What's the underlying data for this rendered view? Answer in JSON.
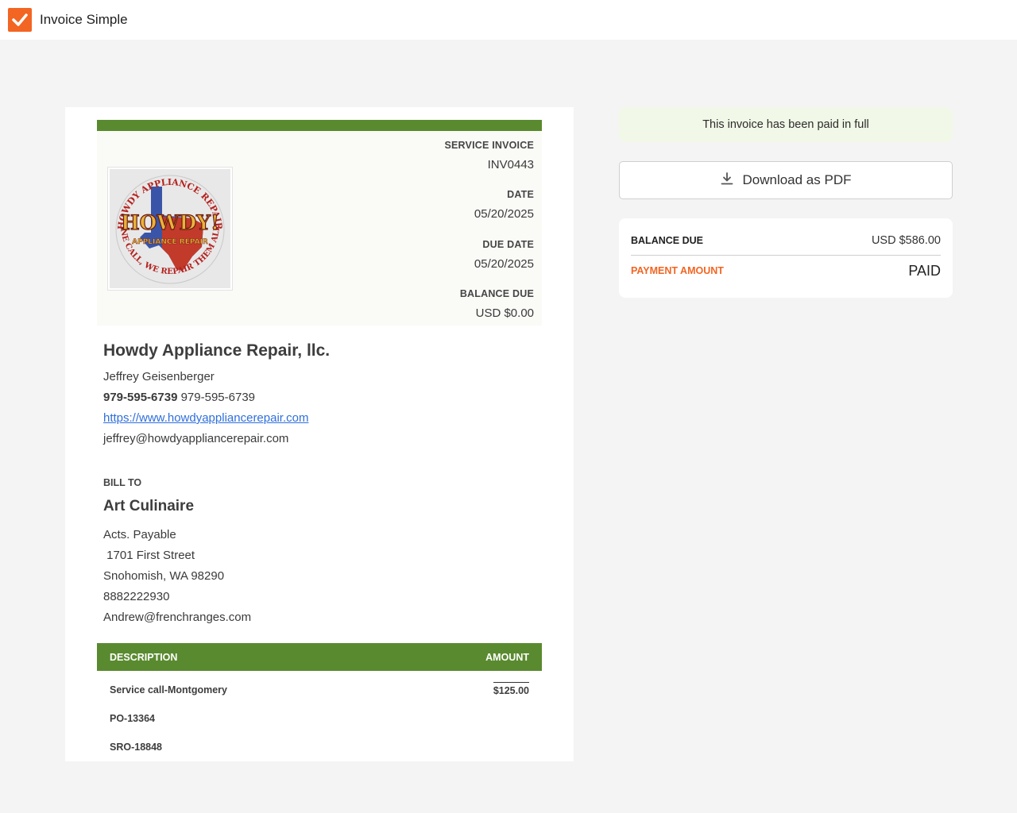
{
  "app": {
    "name": "Invoice Simple"
  },
  "invoice": {
    "type_label": "SERVICE INVOICE",
    "number": "INV0443",
    "date_label": "DATE",
    "date": "05/20/2025",
    "due_date_label": "DUE DATE",
    "due_date": "05/20/2025",
    "balance_label": "BALANCE DUE",
    "balance": "USD $0.00",
    "logo": {
      "arc_top": "HOWDY APPLIANCE REPAIR",
      "arc_bottom": "ONE CALL, WE REPAIR THEM ALL!",
      "center": "HOWDY!",
      "sub": "APPLIANCE REPAIR"
    }
  },
  "company": {
    "name": "Howdy Appliance Repair, llc.",
    "contact": "Jeffrey Geisenberger",
    "phone_bold": "979-595-6739",
    "phone": " 979-595-6739",
    "website": "https://www.howdyappliancerepair.com",
    "email": "jeffrey@howdyappliancerepair.com"
  },
  "bill_to": {
    "label": "BILL TO",
    "name": "Art Culinaire",
    "lines": [
      "Acts. Payable",
      " 1701 First Street",
      "Snohomish, WA 98290",
      "8882222930",
      "Andrew@frenchranges.com"
    ]
  },
  "table": {
    "headers": {
      "description": "DESCRIPTION",
      "amount": "AMOUNT"
    },
    "rows": [
      {
        "description": "Service call-Montgomery",
        "amount": "$125.00"
      },
      {
        "description": "PO-13364"
      },
      {
        "description": "SRO-18848"
      }
    ]
  },
  "sidebar": {
    "paid_message": "This invoice has been paid in full",
    "download_label": "Download as PDF",
    "balance_label": "BALANCE DUE",
    "balance_value": "USD $586.00",
    "payment_label": "PAYMENT AMOUNT",
    "payment_value": "PAID"
  },
  "colors": {
    "brand": "#f26522",
    "accent_green": "#5a8a2f",
    "paid_banner": "#f1f8e7"
  }
}
